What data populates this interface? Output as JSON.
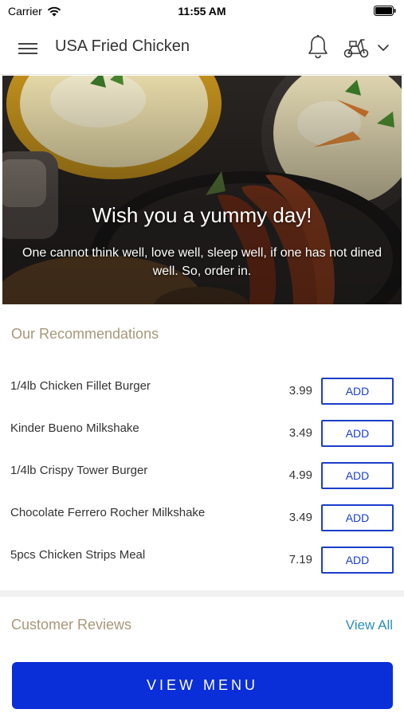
{
  "status_bar": {
    "carrier": "Carrier",
    "time": "11:55 AM"
  },
  "header": {
    "title": "USA Fried Chicken",
    "icons": [
      "hamburger-menu-icon",
      "bell-icon",
      "scooter-icon",
      "chevron-down-icon"
    ]
  },
  "hero": {
    "title": "Wish you a yummy day!",
    "subtitle": "One cannot think well, love well, sleep well, if one has not dined well. So, order in."
  },
  "recommendations": {
    "title": "Our Recommendations",
    "items": [
      {
        "name": "1/4lb Chicken Fillet Burger",
        "price": "3.99",
        "action": "ADD"
      },
      {
        "name": "Kinder Bueno Milkshake",
        "price": "3.49",
        "action": "ADD"
      },
      {
        "name": "1/4lb Crispy Tower Burger",
        "price": "4.99",
        "action": "ADD"
      },
      {
        "name": "Chocolate Ferrero Rocher Milkshake",
        "price": "3.49",
        "action": "ADD"
      },
      {
        "name": "5pcs Chicken Strips Meal",
        "price": "7.19",
        "action": "ADD"
      }
    ]
  },
  "reviews": {
    "title": "Customer Reviews",
    "view_all": "View All"
  },
  "footer": {
    "view_menu": "VIEW MENU"
  },
  "colors": {
    "accent_blue": "#0a2ed8",
    "add_button_border": "#1a3ec9",
    "section_title": "#a8977a",
    "link": "#2a8fbd"
  }
}
